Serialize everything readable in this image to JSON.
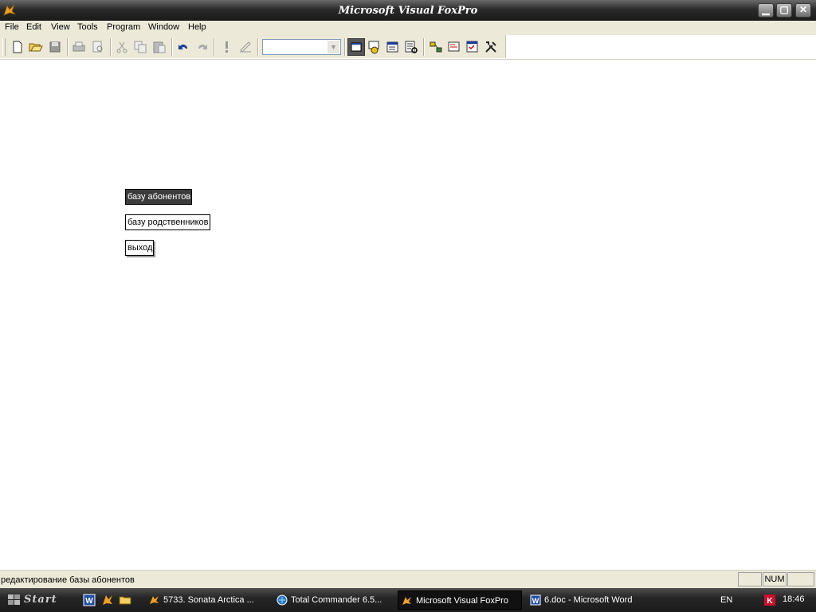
{
  "window": {
    "title": "Microsoft Visual FoxPro",
    "app_icon": "fox-icon"
  },
  "menu": [
    {
      "label": "File"
    },
    {
      "label": "Edit"
    },
    {
      "label": "View"
    },
    {
      "label": "Tools"
    },
    {
      "label": "Program"
    },
    {
      "label": "Window"
    },
    {
      "label": "Help"
    }
  ],
  "toolbar": {
    "buttons": [
      "new-icon",
      "open-icon",
      "save-icon",
      "print-icon",
      "print-preview-icon",
      "cut-icon",
      "copy-icon",
      "paste-icon",
      "undo-icon",
      "redo-icon",
      "run-icon",
      "modify-form-icon",
      "command-window-icon",
      "data-session-icon",
      "properties-icon",
      "code-icon",
      "form-designer-icon",
      "class-browser-icon",
      "component-gallery-icon",
      "tools-icon"
    ],
    "combo_value": ""
  },
  "form": {
    "buttons": [
      {
        "label": "базу абонентов",
        "selected": true
      },
      {
        "label": "базу родственников",
        "selected": false
      },
      {
        "label": "выход",
        "selected": false
      }
    ]
  },
  "status": {
    "text": "редактирование базы абонентов",
    "num": "NUM"
  },
  "taskbar": {
    "start": "Start",
    "tasks": [
      {
        "label": "5733. Sonata Arctica ...",
        "icon": "winamp-icon",
        "active": false
      },
      {
        "label": "Total Commander 6.5...",
        "icon": "total-commander-icon",
        "active": false
      },
      {
        "label": "Microsoft Visual FoxPro",
        "icon": "fox-icon",
        "active": true
      },
      {
        "label": "6.doc - Microsoft Word",
        "icon": "word-icon",
        "active": false
      }
    ],
    "lang": "EN",
    "clock": "18:46"
  },
  "colors": {
    "titlebar": "#2b2b2b",
    "menubar": "#ece9d8",
    "selected_button": "#3c3c3c",
    "taskbar": "#262626"
  }
}
